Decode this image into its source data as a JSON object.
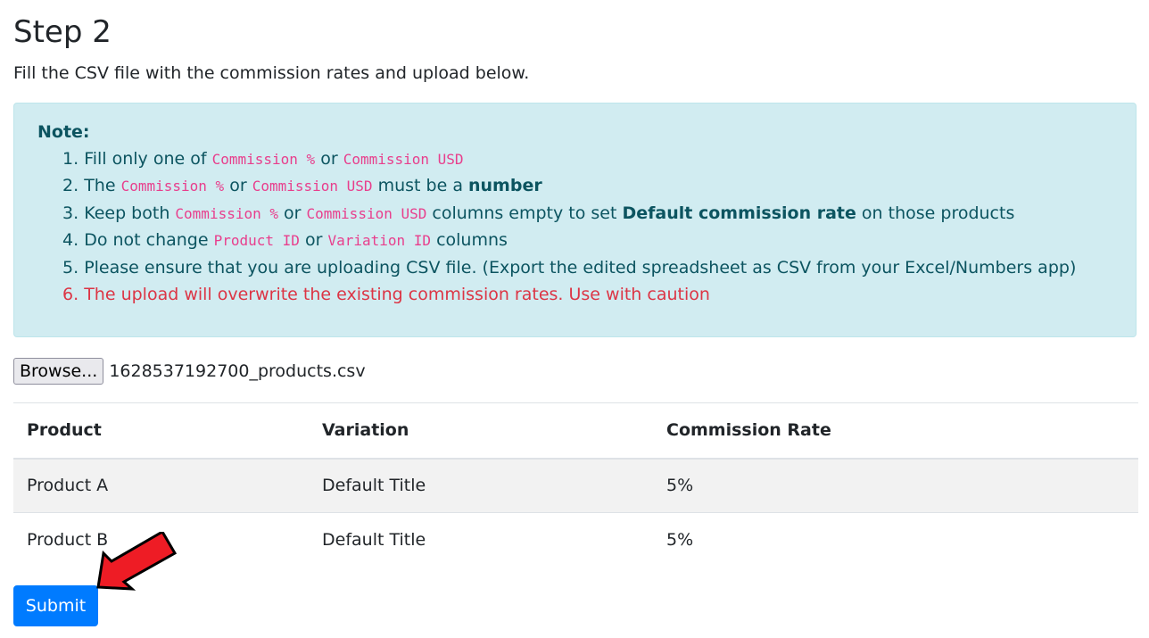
{
  "heading": "Step 2",
  "lead": "Fill the CSV file with the commission rates and upload below.",
  "note": {
    "title": "Note:",
    "items": [
      {
        "num": "1.",
        "t1": "Fill only one of ",
        "c1": "Commission %",
        "t2": " or ",
        "c2": "Commission USD"
      },
      {
        "num": "2.",
        "t1": "The ",
        "c1": "Commission %",
        "t2": " or ",
        "c2": "Commission USD",
        "t3": " must be a ",
        "b1": "number"
      },
      {
        "num": "3.",
        "t1": "Keep both ",
        "c1": "Commission %",
        "t2": " or ",
        "c2": "Commission USD",
        "t3": " columns empty to set ",
        "b1": "Default commission rate",
        "t4": " on those products"
      },
      {
        "num": "4.",
        "t1": "Do not change ",
        "c1": "Product ID",
        "t2": " or ",
        "c2": "Variation ID",
        "t3": " columns"
      },
      {
        "num": "5.",
        "t1": "Please ensure that you are uploading CSV file. (Export the edited spreadsheet as CSV from your Excel/Numbers app)"
      },
      {
        "num": "6.",
        "t1": "The upload will overwrite the existing commission rates. Use with caution"
      }
    ]
  },
  "file": {
    "browse_label": "Browse...",
    "filename": "1628537192700_products.csv"
  },
  "table": {
    "headers": [
      "Product",
      "Variation",
      "Commission Rate"
    ],
    "rows": [
      [
        "Product A",
        "Default Title",
        "5%"
      ],
      [
        "Product B",
        "Default Title",
        "5%"
      ]
    ]
  },
  "submit_label": "Submit",
  "colors": {
    "primary": "#007bff",
    "info_bg": "#d1ecf1",
    "info_text": "#0c5460",
    "danger": "#dc3545",
    "code": "#e83e8c",
    "annotation_arrow": "#ee1c25"
  }
}
